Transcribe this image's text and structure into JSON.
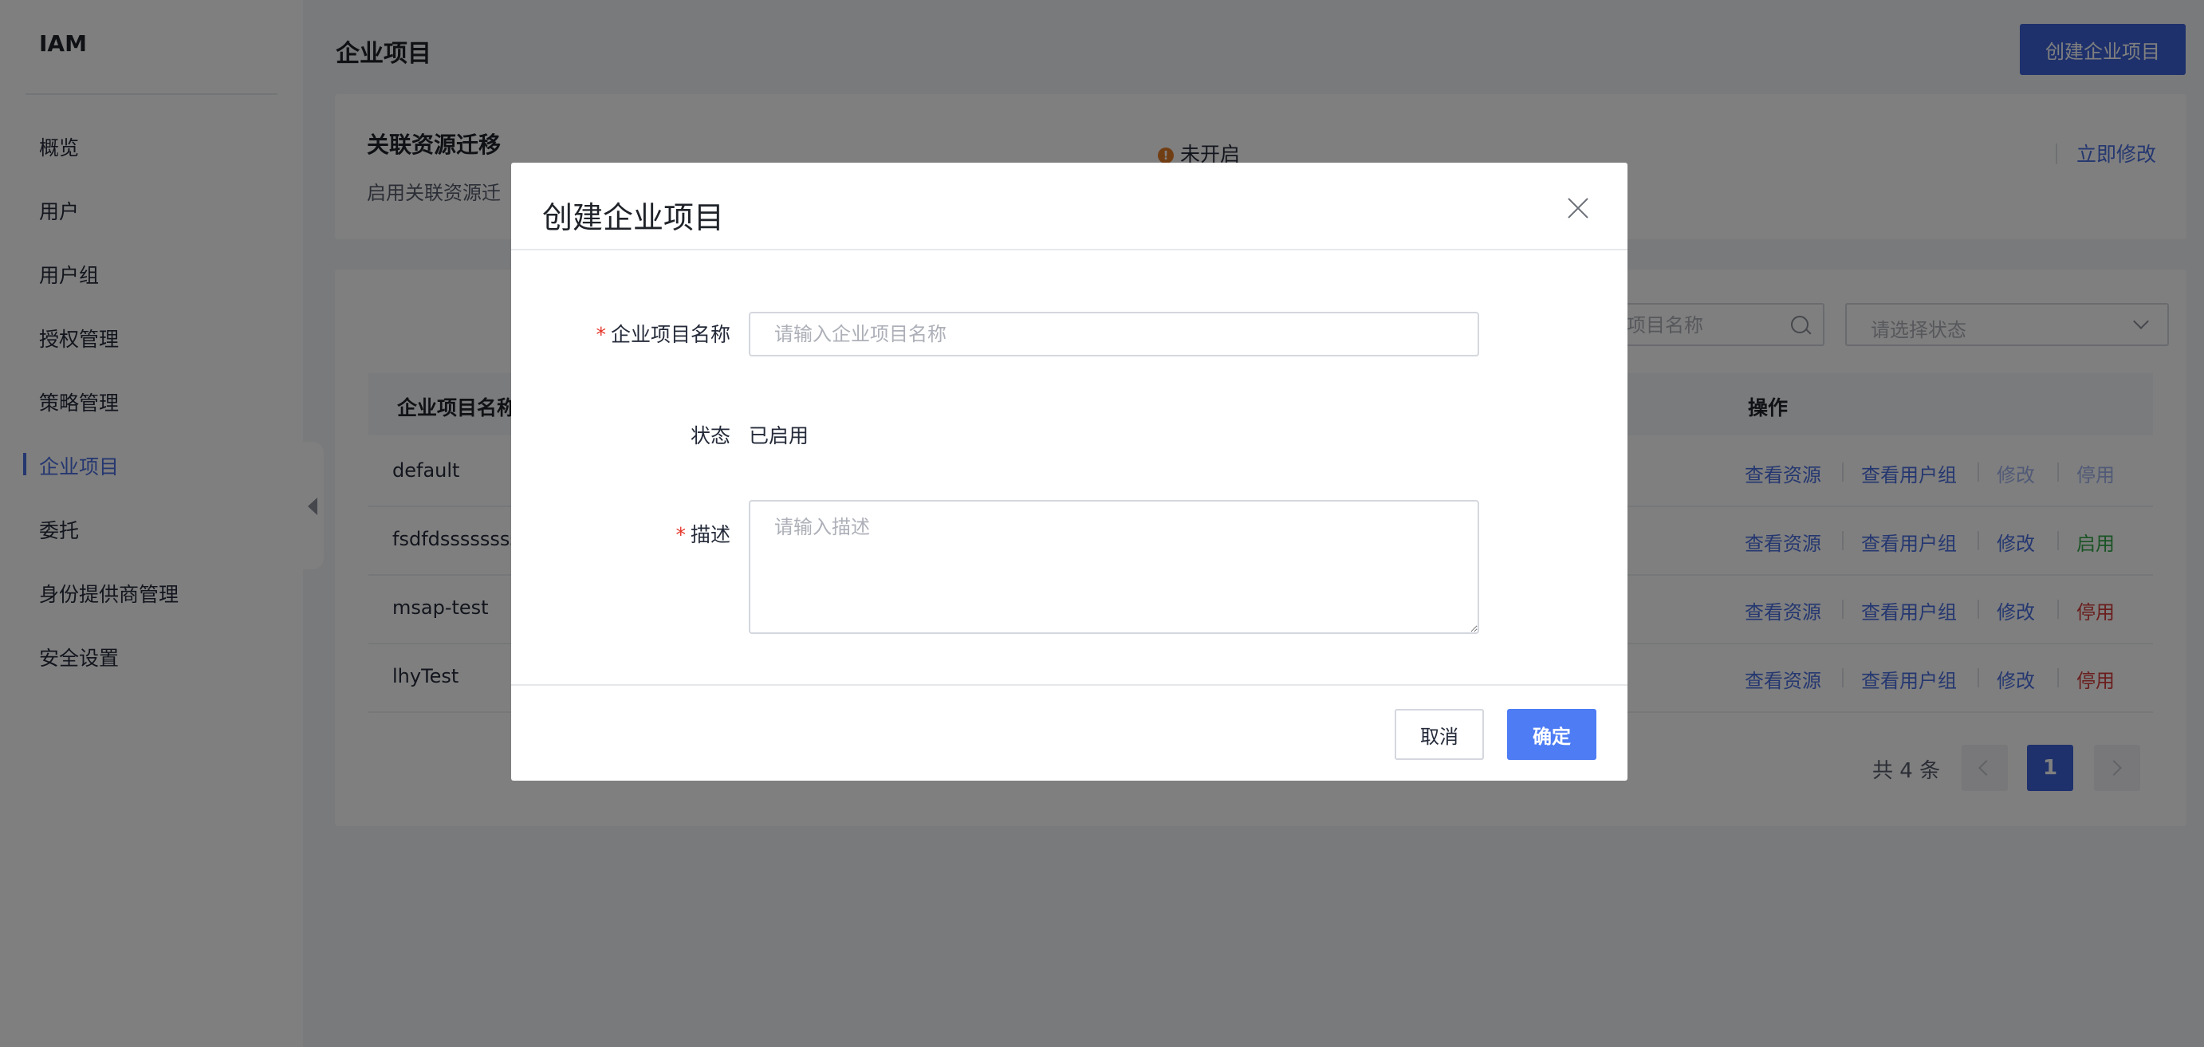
{
  "sidebar": {
    "brand": "IAM",
    "items": [
      {
        "label": "概览"
      },
      {
        "label": "用户"
      },
      {
        "label": "用户组"
      },
      {
        "label": "授权管理"
      },
      {
        "label": "策略管理"
      },
      {
        "label": "企业项目"
      },
      {
        "label": "委托"
      },
      {
        "label": "身份提供商管理"
      },
      {
        "label": "安全设置"
      }
    ],
    "active_index": 5
  },
  "header": {
    "title": "企业项目",
    "create_button": "创建企业项目"
  },
  "migration_card": {
    "title": "关联资源迁移",
    "description": "启用关联资源迁",
    "description_tail": "。",
    "status_icon": "warning-icon",
    "status": "未开启",
    "modify_link": "立即修改"
  },
  "filters": {
    "search_placeholder": "业项目名称",
    "status_placeholder": "请选择状态"
  },
  "table": {
    "columns": [
      "企业项目名称",
      "操作"
    ],
    "rows": [
      {
        "name": "default",
        "actions": [
          "查看资源",
          "查看用户组",
          "修改",
          "停用"
        ]
      },
      {
        "name": "fsdfdssssssss",
        "actions": [
          "查看资源",
          "查看用户组",
          "修改",
          "启用"
        ]
      },
      {
        "name": "msap-test",
        "actions": [
          "查看资源",
          "查看用户组",
          "修改",
          "停用"
        ]
      },
      {
        "name": "lhyTest",
        "actions": [
          "查看资源",
          "查看用户组",
          "修改",
          "停用"
        ]
      }
    ]
  },
  "pagination": {
    "total_text": "共 4 条",
    "current_page": "1"
  },
  "dialog": {
    "title": "创建企业项目",
    "name_label": "企业项目名称",
    "name_placeholder": "请输入企业项目名称",
    "name_value": "",
    "status_label": "状态",
    "status_value": "已启用",
    "desc_label": "描述",
    "desc_placeholder": "请输入描述",
    "desc_value": "",
    "required_mark": "*",
    "cancel": "取消",
    "ok": "确定"
  },
  "colors": {
    "primary": "#3d62d9",
    "link": "#4a6ee0",
    "enable": "#35a84a",
    "disable": "#d63d3d",
    "required": "#e5352a",
    "warning": "#e37d29"
  }
}
